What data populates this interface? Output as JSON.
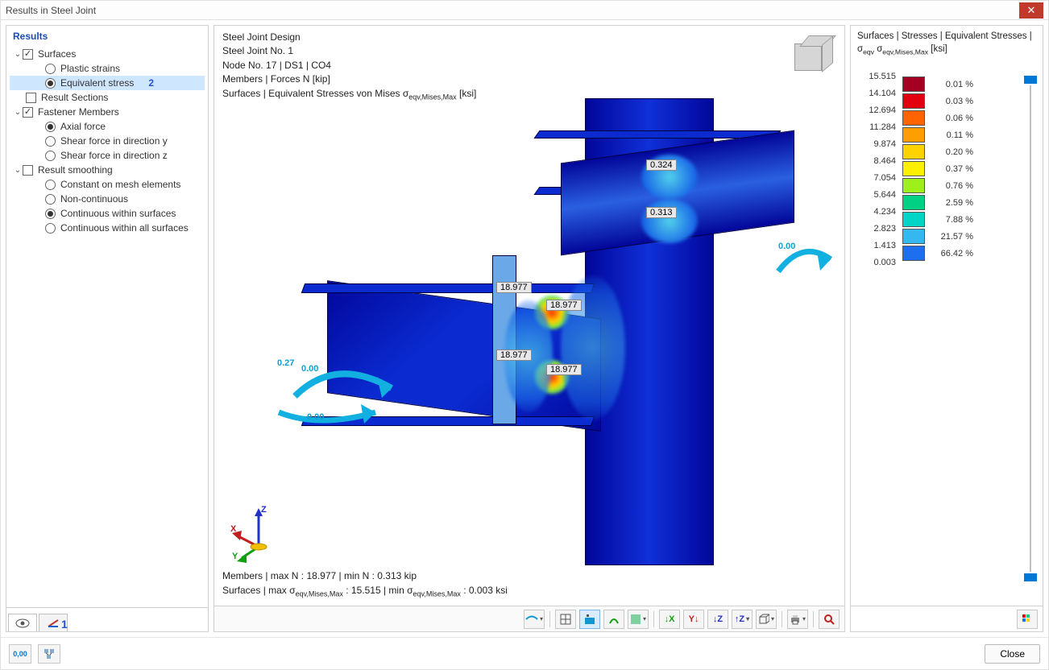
{
  "window": {
    "title": "Results in Steel Joint"
  },
  "sidebar": {
    "header": "Results",
    "annotation1": "1",
    "annotation2": "2",
    "items": {
      "surfaces": "Surfaces",
      "plastic_strains": "Plastic strains",
      "equivalent_stress": "Equivalent stress",
      "result_sections": "Result Sections",
      "fastener_members": "Fastener Members",
      "axial_force": "Axial force",
      "shear_y": "Shear force in direction y",
      "shear_z": "Shear force in direction z",
      "result_smoothing": "Result smoothing",
      "constant_mesh": "Constant on mesh elements",
      "non_continuous": "Non-continuous",
      "cont_within_surfaces": "Continuous within surfaces",
      "cont_within_all": "Continuous within all surfaces"
    }
  },
  "viewport": {
    "header_lines": [
      "Steel Joint Design",
      "Steel Joint No. 1",
      "Node No. 17 | DS1 | CO4",
      "Members | Forces N [kip]",
      "Surfaces | Equivalent Stresses von Mises σ<sub>eqv,Mises,Max</sub> [ksi]"
    ],
    "footer_lines": [
      "Members | max N : 18.977 | min N : 0.313 kip",
      "Surfaces | max σ<sub>eqv,Mises,Max</sub> : 15.515 | min σ<sub>eqv,Mises,Max</sub> : 0.003 ksi"
    ],
    "triad": {
      "x": "X",
      "y": "Y",
      "z": "Z"
    },
    "stress_labels": [
      "0.324",
      "0.313",
      "18.977",
      "18.977",
      "18.977",
      "18.977"
    ],
    "force_labels": [
      "0.27",
      "0.00",
      "0.00",
      "0.00"
    ]
  },
  "legend": {
    "header": "Surfaces | Stresses | Equivalent Stresses | σ<sub>eqv</sub> σ<sub>eqv,Mises,Max</sub> [ksi]",
    "values": [
      "15.515",
      "14.104",
      "12.694",
      "11.284",
      "9.874",
      "8.464",
      "7.054",
      "5.644",
      "4.234",
      "2.823",
      "1.413",
      "0.003"
    ],
    "colors": [
      "#a50021",
      "#e3000f",
      "#ff6400",
      "#ff9e00",
      "#ffd300",
      "#fff000",
      "#9ef01a",
      "#00d084",
      "#00d5c8",
      "#35b8f0",
      "#1e6ff0",
      "#000099"
    ],
    "percents": [
      "0.01 %",
      "0.03 %",
      "0.06 %",
      "0.11 %",
      "0.20 %",
      "0.37 %",
      "0.76 %",
      "2.59 %",
      "7.88 %",
      "21.57 %",
      "66.42 %"
    ]
  },
  "bottombar": {
    "close": "Close"
  }
}
